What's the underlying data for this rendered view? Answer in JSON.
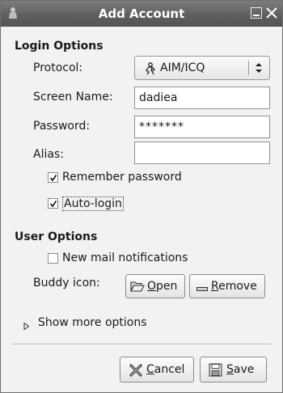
{
  "window": {
    "title": "Add Account"
  },
  "login_options": {
    "heading": "Login Options",
    "protocol": {
      "label": "Protocol:",
      "value": "AIM/ICQ"
    },
    "screen_name": {
      "label": "Screen Name:",
      "value": "dadiea"
    },
    "password": {
      "label": "Password:",
      "value": "*******"
    },
    "alias": {
      "label": "Alias:",
      "value": ""
    },
    "remember_password": {
      "label": "Remember password",
      "checked": true
    },
    "auto_login": {
      "label": "Auto-login",
      "checked": true
    }
  },
  "user_options": {
    "heading": "User Options",
    "new_mail": {
      "label": "New mail notifications",
      "checked": false
    },
    "buddy_icon": {
      "label": "Buddy icon:"
    },
    "open_button": {
      "mnemonic": "O",
      "rest": "pen"
    },
    "remove_button": {
      "mnemonic": "R",
      "rest": "emove"
    }
  },
  "expander": {
    "label": "Show more options"
  },
  "buttons": {
    "cancel": {
      "mnemonic": "C",
      "rest": "ancel"
    },
    "save": {
      "mnemonic": "S",
      "rest": "ave"
    }
  },
  "icons": [
    "app-icon",
    "minimize-icon",
    "close-icon",
    "aim-icq-icon",
    "combo-arrows-icon",
    "check-icon",
    "folder-open-icon",
    "remove-icon",
    "expander-arrow-icon",
    "cancel-icon",
    "save-icon"
  ]
}
